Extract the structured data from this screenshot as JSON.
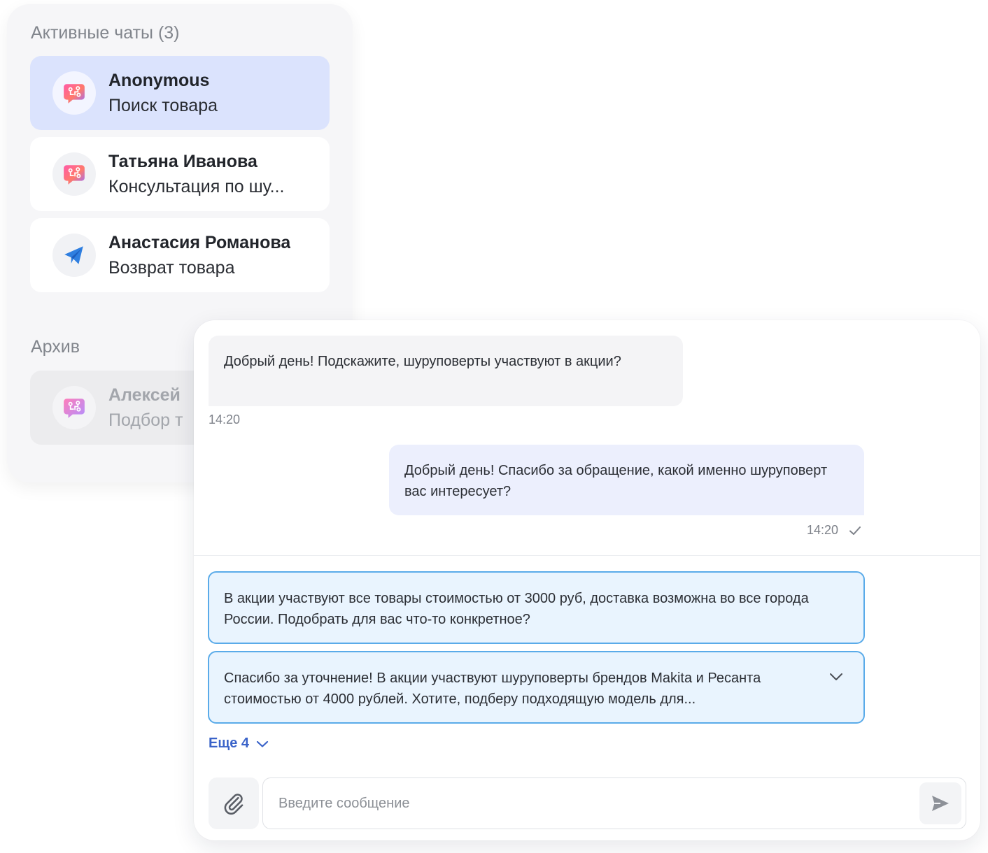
{
  "chat_list": {
    "active_title": "Активные чаты (3)",
    "archive_title": "Архив",
    "active_chats": [
      {
        "name": "Anonymous",
        "topic": "Поиск товара",
        "channel_icon": "chat-bot-icon"
      },
      {
        "name": "Татьяна Иванова",
        "topic": "Консультация по шу...",
        "channel_icon": "chat-bot-icon"
      },
      {
        "name": "Анастасия Романова",
        "topic": "Возврат товара",
        "channel_icon": "telegram-icon"
      }
    ],
    "archived_chats": [
      {
        "name": "Алексей",
        "topic": "Подбор т",
        "channel_icon": "chat-bot-icon"
      }
    ]
  },
  "conversation": {
    "messages": [
      {
        "direction": "incoming",
        "text": "Добрый день! Подскажите, шуруповерты участвуют в акции?",
        "time": "14:20"
      },
      {
        "direction": "outgoing",
        "text": "Добрый день! Спасибо за обращение, какой именно шуруповерт вас интересует?",
        "time": "14:20",
        "status_icon": "check-icon"
      }
    ],
    "suggestions": [
      {
        "text": "В акции участвуют все товары стоимостью от 3000 руб, доставка возможна во все города России. Подобрать для вас что-то конкретное?"
      },
      {
        "text": "Спасибо за уточнение! В акции участвуют шуруповерты брендов Makita и Ресанта стоимостью от 4000 рублей. Хотите, подберу подходящую модель для...",
        "expand_icon": "chevron-down-icon"
      }
    ],
    "more_label": "Еще 4",
    "input": {
      "placeholder": "Введите сообщение",
      "value": ""
    }
  },
  "colors": {
    "active_chat_bg": "#dbe3fd",
    "outgoing_bubble_bg": "#eceffd",
    "incoming_bubble_bg": "#f4f4f6",
    "suggestion_bg": "#e9f4fe",
    "suggestion_border": "#5aabe9",
    "link": "#3a63c9",
    "telegram": "#2f7fe0"
  }
}
